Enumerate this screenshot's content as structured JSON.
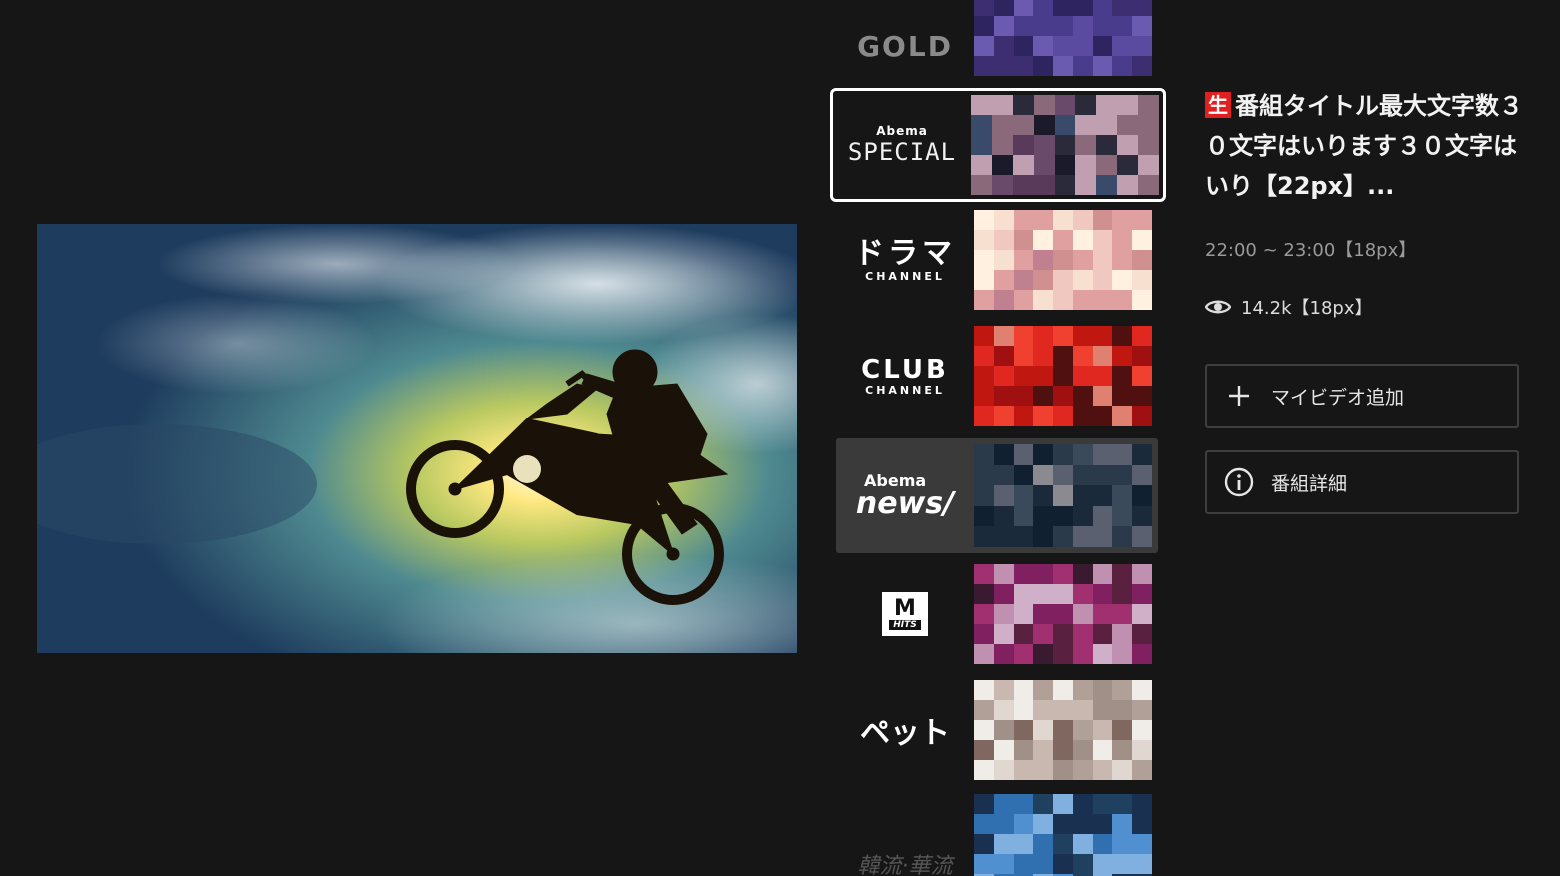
{
  "player": {
    "scene": "motocross-jump-silhouette"
  },
  "channels": [
    {
      "id": "gold",
      "logo_text": "GOLD",
      "thumb_palette": [
        "#4a3c8c",
        "#3c2e70",
        "#5a4aa0",
        "#2e2460",
        "#6a5ab0"
      ]
    },
    {
      "id": "special",
      "logo_top": "Abema",
      "logo_text": "SPECIAL",
      "state": "focused",
      "thumb_palette": [
        "#2a2a3a",
        "#5a3a5a",
        "#8a6a7a",
        "#3a4a6a",
        "#c0a0b0",
        "#1a1a2a",
        "#6a4a6a"
      ]
    },
    {
      "id": "drama",
      "logo_text": "ドラマ",
      "logo_sub": "CHANNEL",
      "thumb_palette": [
        "#f0c8c0",
        "#e0a0a0",
        "#fff0e0",
        "#c08090",
        "#f8e0d0",
        "#d09090"
      ]
    },
    {
      "id": "club",
      "logo_text": "CLUB",
      "logo_sub": "CHANNEL",
      "thumb_palette": [
        "#e02820",
        "#c01810",
        "#f04030",
        "#a01010",
        "#e08070",
        "#501010"
      ]
    },
    {
      "id": "news",
      "logo_top": "Abema",
      "logo_text": "news/",
      "state": "highlighted",
      "thumb_palette": [
        "#1a2a3a",
        "#2a3a4a",
        "#3a4a5a",
        "#5a6070",
        "#8a8a90",
        "#102030"
      ]
    },
    {
      "id": "mtv-hits",
      "logo_text": "M",
      "logo_sub": "HITS",
      "thumb_palette": [
        "#a03070",
        "#5a2040",
        "#d0b0c8",
        "#3a1a30",
        "#802060",
        "#c090b0"
      ]
    },
    {
      "id": "pet",
      "logo_text": "ペット",
      "thumb_palette": [
        "#c8b8b0",
        "#a09088",
        "#e0d8d0",
        "#806860",
        "#b0a098",
        "#f0ece8"
      ]
    },
    {
      "id": "korean",
      "logo_text": "韓流·華流",
      "thumb_palette": [
        "#3070b0",
        "#5090d0",
        "#204060",
        "#80b0e0",
        "#1a3050"
      ]
    }
  ],
  "program": {
    "live_badge": "生",
    "title": "番組タイトル最大文字数３０文字はいります３０文字はいり【22px】...",
    "time": "22:00 ~ 23:00【18px】",
    "views": "14.2k【18px】"
  },
  "buttons": {
    "add": "マイビデオ追加",
    "detail": "番組詳細"
  },
  "colors": {
    "background": "#161616",
    "live": "#e02020",
    "focus_border": "#ffffff",
    "highlight": "#3a3a3a"
  }
}
